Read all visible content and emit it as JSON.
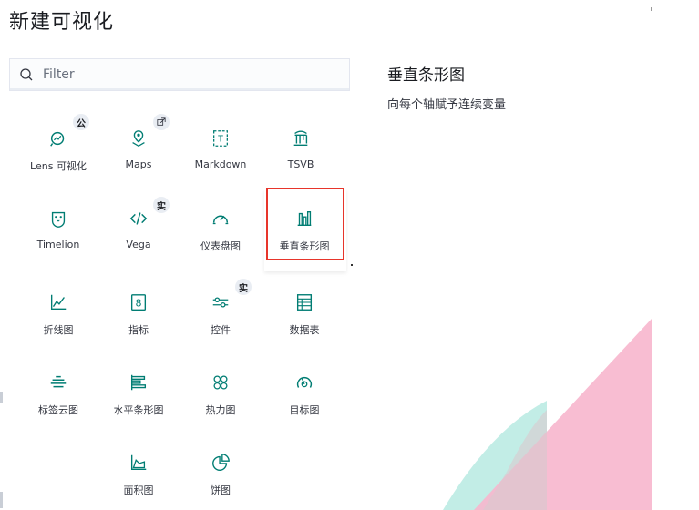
{
  "page": {
    "title": "新建可视化"
  },
  "search": {
    "placeholder": "Filter",
    "value": ""
  },
  "detail": {
    "title": "垂直条形图",
    "description": "向每个轴赋予连续变量"
  },
  "colors": {
    "icon": "#017d73",
    "selected_border": "#e7352b",
    "accent_pink": "#f4a7c3",
    "accent_teal": "#9ee0d6"
  },
  "tiles": [
    {
      "label": "Lens 可视化",
      "icon": "lens-icon",
      "badge": "公"
    },
    {
      "label": "Maps",
      "icon": "map-pin-icon",
      "badge": "external-link-icon"
    },
    {
      "label": "Markdown",
      "icon": "markdown-icon"
    },
    {
      "label": "TSVB",
      "icon": "tsvb-icon"
    },
    {
      "label": "Timelion",
      "icon": "timelion-icon"
    },
    {
      "label": "Vega",
      "icon": "code-icon",
      "badge": "实"
    },
    {
      "label": "仪表盘图",
      "icon": "gauge-icon"
    },
    {
      "label": "垂直条形图",
      "icon": "vertical-bar-icon",
      "selected": true
    },
    {
      "label": "折线图",
      "icon": "line-chart-icon"
    },
    {
      "label": "指标",
      "icon": "metric-icon"
    },
    {
      "label": "控件",
      "icon": "controls-icon",
      "badge": "实"
    },
    {
      "label": "数据表",
      "icon": "table-icon"
    },
    {
      "label": "标签云图",
      "icon": "tag-cloud-icon"
    },
    {
      "label": "水平条形图",
      "icon": "horizontal-bar-icon"
    },
    {
      "label": "热力图",
      "icon": "heatmap-icon"
    },
    {
      "label": "目标图",
      "icon": "goal-icon"
    },
    {
      "label": "面积图",
      "icon": "area-chart-icon"
    },
    {
      "label": "饼图",
      "icon": "pie-chart-icon"
    }
  ]
}
